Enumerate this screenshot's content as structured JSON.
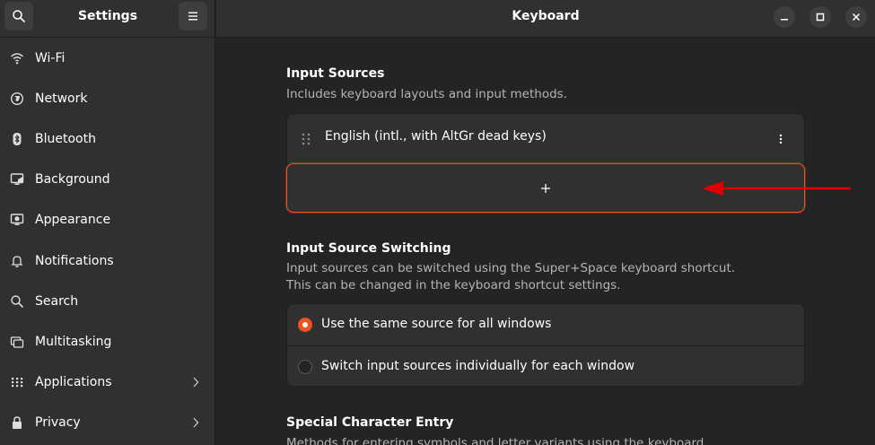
{
  "sidebar": {
    "title": "Settings",
    "search_icon": "search-icon",
    "menu_icon": "hamburger-menu-icon",
    "items": [
      {
        "label": "Wi-Fi",
        "icon": "wifi-icon"
      },
      {
        "label": "Network",
        "icon": "network-icon"
      },
      {
        "label": "Bluetooth",
        "icon": "bluetooth-icon"
      },
      {
        "label": "Background",
        "icon": "background-icon"
      },
      {
        "label": "Appearance",
        "icon": "appearance-icon"
      },
      {
        "label": "Notifications",
        "icon": "bell-icon"
      },
      {
        "label": "Search",
        "icon": "search-icon"
      },
      {
        "label": "Multitasking",
        "icon": "multitasking-icon"
      },
      {
        "label": "Applications",
        "icon": "grid-icon",
        "has_chevron": true
      },
      {
        "label": "Privacy",
        "icon": "lock-icon",
        "has_chevron": true
      }
    ]
  },
  "header": {
    "title": "Keyboard",
    "controls": [
      "minimize-icon",
      "maximize-icon",
      "close-icon"
    ]
  },
  "input_sources": {
    "title": "Input Sources",
    "description": "Includes keyboard layouts and input methods.",
    "sources": [
      {
        "label": "English (intl., with AltGr dead keys)"
      }
    ],
    "add_icon": "plus-icon"
  },
  "switching": {
    "title": "Input Source Switching",
    "description_line1": "Input sources can be switched using the Super+Space keyboard shortcut.",
    "description_line2": "This can be changed in the keyboard shortcut settings.",
    "options": [
      {
        "label": "Use the same source for all windows",
        "selected": true
      },
      {
        "label": "Switch input sources individually for each window",
        "selected": false
      }
    ]
  },
  "special_chars": {
    "title": "Special Character Entry",
    "description": "Methods for entering symbols and letter variants using the keyboard."
  },
  "colors": {
    "accent": "#e95420",
    "annotation_arrow": "#e00000",
    "sidebar_bg": "#303030",
    "main_bg": "#242424"
  }
}
